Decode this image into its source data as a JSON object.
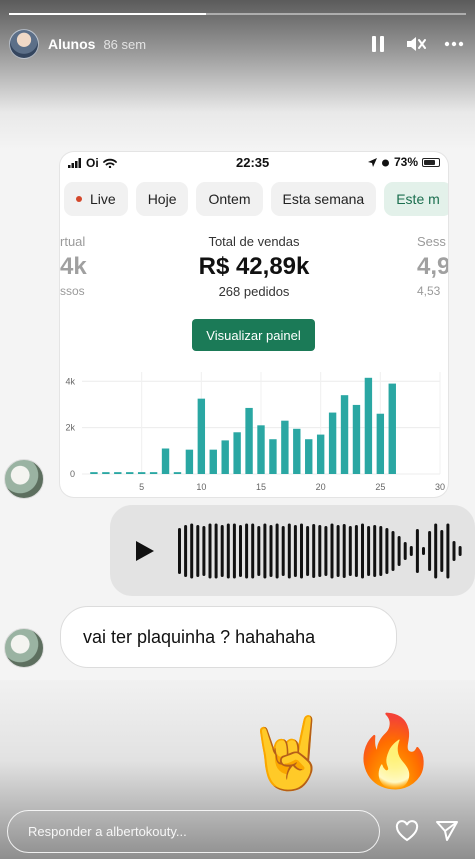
{
  "story": {
    "username": "Alunos",
    "time_ago": "86 sem",
    "progress": 0.43,
    "icons": [
      "pause-icon",
      "mute-icon",
      "more-icon"
    ]
  },
  "screenshot": {
    "status": {
      "carrier": "Oi",
      "clock": "22:35",
      "battery": "73%"
    },
    "filters": [
      {
        "label": "Live",
        "dot": true
      },
      {
        "label": "Hoje"
      },
      {
        "label": "Ontem"
      },
      {
        "label": "Esta semana"
      },
      {
        "label": "Este m",
        "active": true
      }
    ],
    "left_stat": {
      "label": "rtual",
      "value": "4k",
      "sub": "ssos"
    },
    "main_stat": {
      "label": "Total de vendas",
      "value": "R$ 42,89k",
      "sub": "268 pedidos"
    },
    "right_stat": {
      "label": "Sess",
      "value": "4,9",
      "sub": "4,53"
    },
    "panel_button": "Visualizar painel"
  },
  "chart_data": {
    "type": "bar",
    "x": [
      1,
      2,
      3,
      4,
      5,
      6,
      7,
      8,
      9,
      10,
      11,
      12,
      13,
      14,
      15,
      16,
      17,
      18,
      19,
      20,
      21,
      22,
      23,
      24,
      25,
      26
    ],
    "values": [
      80,
      80,
      80,
      80,
      80,
      80,
      1100,
      80,
      1050,
      3250,
      1050,
      1450,
      1800,
      2850,
      2100,
      1500,
      2300,
      1950,
      1500,
      1700,
      2650,
      3400,
      2980,
      4150,
      2600,
      3900
    ],
    "x_ticks": [
      5,
      10,
      15,
      20,
      25,
      30
    ],
    "y_ticks": [
      "0",
      "2k",
      "4k"
    ],
    "xlim": [
      0,
      30
    ],
    "ylim": [
      0,
      4400
    ],
    "color": "#2aa7a3",
    "grid": true
  },
  "messages": {
    "text": "vai ter plaquinha ? hahahaha",
    "stickers": [
      "🤘",
      "🔥"
    ]
  },
  "reply": {
    "placeholder": "Responder a albertokouty..."
  },
  "colors": {
    "accent": "#1b7a57",
    "bars": "#2aa7a3",
    "live_dot": "#d3472b"
  }
}
